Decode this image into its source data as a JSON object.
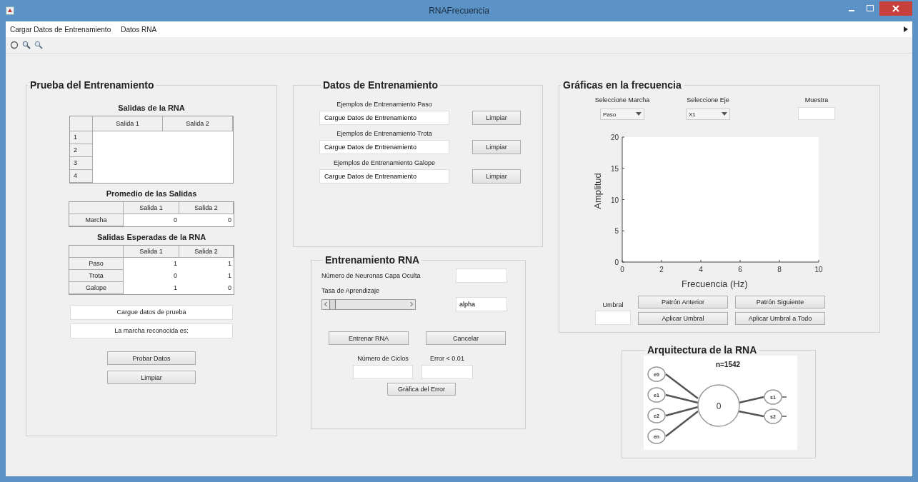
{
  "window": {
    "title": "RNAFrecuencia"
  },
  "menu": [
    "Cargar Datos de Entrenamiento",
    "Datos RNA"
  ],
  "prueba": {
    "title": "Prueba del Entrenamiento",
    "tables": [
      {
        "title": "Salidas de la RNA",
        "kind": "wide",
        "columns": [
          "Salida 1",
          "Salida 2"
        ],
        "rows": [
          {
            "label": "1"
          },
          {
            "label": "2"
          },
          {
            "label": "3"
          },
          {
            "label": "4"
          }
        ]
      },
      {
        "title": "Promedio de las Salidas",
        "kind": "labeled",
        "columns": [
          "Salida 1",
          "Salida 2"
        ],
        "rows": [
          {
            "label": "Marcha",
            "cells": [
              "0",
              "0"
            ]
          }
        ]
      },
      {
        "title": "Salidas Esperadas de la RNA",
        "kind": "labeled",
        "columns": [
          "Salida 1",
          "Salida 2"
        ],
        "rows": [
          {
            "label": "Paso",
            "cells": [
              "1",
              "1"
            ]
          },
          {
            "label": "Trota",
            "cells": [
              "0",
              "1"
            ]
          },
          {
            "label": "Galope",
            "cells": [
              "1",
              "0"
            ]
          }
        ]
      }
    ],
    "texts": [
      "Cargue datos de prueba",
      "La marcha reconocida es:"
    ],
    "buttons": [
      "Probar Datos",
      "Limpiar"
    ]
  },
  "datos": {
    "title": "Datos de Entrenamiento",
    "groups": [
      {
        "label": "Ejemplos de Entrenamiento Paso",
        "value": "Cargue Datos de Entrenamiento",
        "button": "Limpiar"
      },
      {
        "label": "Ejemplos de Entrenamiento Trota",
        "value": "Cargue Datos de Entrenamiento",
        "button": "Limpiar"
      },
      {
        "label": "Ejemplos de Entrenamiento Galope",
        "value": "Cargue Datos de Entrenamiento",
        "button": "Limpiar"
      }
    ]
  },
  "entrenamiento": {
    "title": "Entrenamiento RNA",
    "neurons_label": "Número de Neuronas Capa Oculta",
    "rate_label": "Tasa de Aprendizaje",
    "rate_slider": {
      "level": 0
    },
    "alpha_value": "alpha",
    "buttons": [
      "Entrenar RNA",
      "Cancelar"
    ],
    "cycles_label": "Número de Ciclos",
    "error_label": "Error < 0.01",
    "error_button": "Gráfica del Error"
  },
  "graficas": {
    "title": "Gráficas en la frecuencia",
    "marcha": {
      "label": "Seleccione Marcha",
      "value": "Paso"
    },
    "eje": {
      "label": "Seleccione Eje",
      "value": "X1"
    },
    "muestra_label": "Muestra",
    "chart_data": {
      "type": "line",
      "xlabel": "Frecuencia (Hz)",
      "ylabel": "Amplitud",
      "xlim": [
        0,
        10
      ],
      "ylim": [
        0,
        20
      ],
      "xticks": [
        0,
        2,
        4,
        6,
        8,
        10
      ],
      "yticks": [
        0,
        5,
        10,
        15,
        20
      ]
    },
    "umbral_label": "Umbral",
    "buttons": [
      "Patrón Anterior",
      "Patrón Siguiente",
      "Aplicar Umbral",
      "Aplicar Umbral a Todo"
    ]
  },
  "arquitectura": {
    "title": "Arquitectura de la RNA",
    "n_label": "n=1542",
    "inputs": [
      "e0",
      "e1",
      "e2",
      "en"
    ],
    "neuron": "0",
    "outputs": [
      "s1",
      "s2"
    ]
  }
}
